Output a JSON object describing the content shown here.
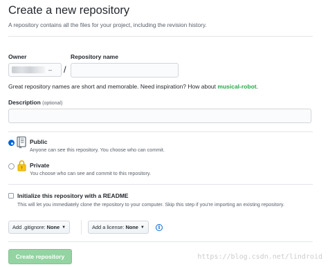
{
  "page": {
    "title": "Create a new repository",
    "subtitle": "A repository contains all the files for your project, including the revision history."
  },
  "owner": {
    "label": "Owner",
    "value_obscured": true,
    "caret": "–"
  },
  "separator": "/",
  "repository_name": {
    "label": "Repository name",
    "value": "",
    "placeholder": ""
  },
  "name_hint": {
    "text": "Great repository names are short and memorable. Need inspiration? How about ",
    "suggestion": "musical-robot",
    "suffix": "."
  },
  "description": {
    "label": "Description",
    "optional_tag": "(optional)",
    "value": "",
    "placeholder": ""
  },
  "visibility": {
    "selected": "public",
    "options": [
      {
        "id": "public",
        "title": "Public",
        "description": "Anyone can see this repository. You choose who can commit.",
        "icon": "repo-book-icon",
        "checked": true
      },
      {
        "id": "private",
        "title": "Private",
        "description": "You choose who can see and commit to this repository.",
        "icon": "lock-icon",
        "checked": false
      }
    ]
  },
  "initialize": {
    "checked": false,
    "title": "Initialize this repository with a README",
    "description": "This will let you immediately clone the repository to your computer. Skip this step if you're importing an existing repository."
  },
  "gitignore": {
    "label": "Add .gitignore:",
    "value": "None"
  },
  "license": {
    "label": "Add a license:",
    "value": "None"
  },
  "info_icon": "info-icon",
  "create_button": {
    "label": "Create repository",
    "disabled": true
  },
  "watermark": "https://blog.csdn.net/lindroid",
  "colors": {
    "accent_blue": "#0366d6",
    "suggestion_green": "#28a745",
    "create_button_disabled": "#94d3a2",
    "text": "#24292e",
    "muted_text": "#586069",
    "border": "#d1d5da"
  }
}
